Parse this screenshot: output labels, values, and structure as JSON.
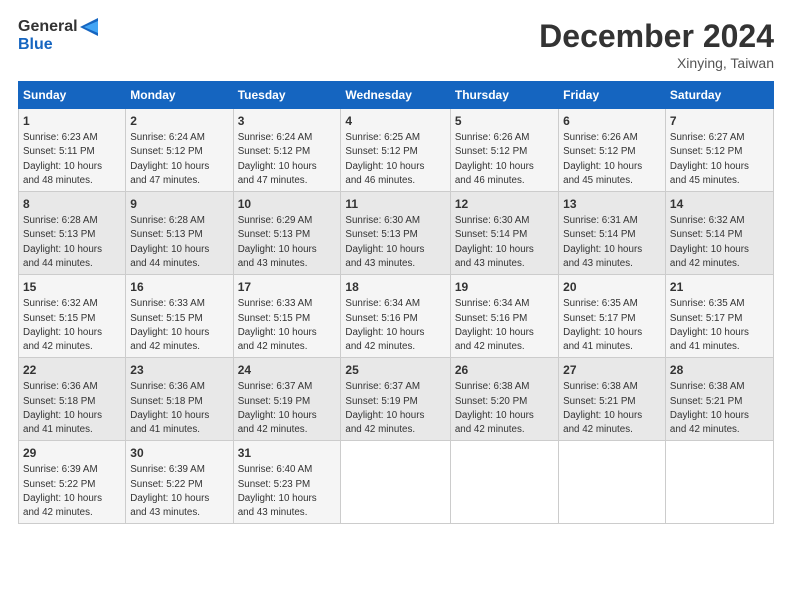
{
  "header": {
    "logo_line1": "General",
    "logo_line2": "Blue",
    "month_title": "December 2024",
    "location": "Xinying, Taiwan"
  },
  "days_of_week": [
    "Sunday",
    "Monday",
    "Tuesday",
    "Wednesday",
    "Thursday",
    "Friday",
    "Saturday"
  ],
  "weeks": [
    [
      {
        "day": "1",
        "info": "Sunrise: 6:23 AM\nSunset: 5:11 PM\nDaylight: 10 hours\nand 48 minutes."
      },
      {
        "day": "2",
        "info": "Sunrise: 6:24 AM\nSunset: 5:12 PM\nDaylight: 10 hours\nand 47 minutes."
      },
      {
        "day": "3",
        "info": "Sunrise: 6:24 AM\nSunset: 5:12 PM\nDaylight: 10 hours\nand 47 minutes."
      },
      {
        "day": "4",
        "info": "Sunrise: 6:25 AM\nSunset: 5:12 PM\nDaylight: 10 hours\nand 46 minutes."
      },
      {
        "day": "5",
        "info": "Sunrise: 6:26 AM\nSunset: 5:12 PM\nDaylight: 10 hours\nand 46 minutes."
      },
      {
        "day": "6",
        "info": "Sunrise: 6:26 AM\nSunset: 5:12 PM\nDaylight: 10 hours\nand 45 minutes."
      },
      {
        "day": "7",
        "info": "Sunrise: 6:27 AM\nSunset: 5:12 PM\nDaylight: 10 hours\nand 45 minutes."
      }
    ],
    [
      {
        "day": "8",
        "info": "Sunrise: 6:28 AM\nSunset: 5:13 PM\nDaylight: 10 hours\nand 44 minutes."
      },
      {
        "day": "9",
        "info": "Sunrise: 6:28 AM\nSunset: 5:13 PM\nDaylight: 10 hours\nand 44 minutes."
      },
      {
        "day": "10",
        "info": "Sunrise: 6:29 AM\nSunset: 5:13 PM\nDaylight: 10 hours\nand 43 minutes."
      },
      {
        "day": "11",
        "info": "Sunrise: 6:30 AM\nSunset: 5:13 PM\nDaylight: 10 hours\nand 43 minutes."
      },
      {
        "day": "12",
        "info": "Sunrise: 6:30 AM\nSunset: 5:14 PM\nDaylight: 10 hours\nand 43 minutes."
      },
      {
        "day": "13",
        "info": "Sunrise: 6:31 AM\nSunset: 5:14 PM\nDaylight: 10 hours\nand 43 minutes."
      },
      {
        "day": "14",
        "info": "Sunrise: 6:32 AM\nSunset: 5:14 PM\nDaylight: 10 hours\nand 42 minutes."
      }
    ],
    [
      {
        "day": "15",
        "info": "Sunrise: 6:32 AM\nSunset: 5:15 PM\nDaylight: 10 hours\nand 42 minutes."
      },
      {
        "day": "16",
        "info": "Sunrise: 6:33 AM\nSunset: 5:15 PM\nDaylight: 10 hours\nand 42 minutes."
      },
      {
        "day": "17",
        "info": "Sunrise: 6:33 AM\nSunset: 5:15 PM\nDaylight: 10 hours\nand 42 minutes."
      },
      {
        "day": "18",
        "info": "Sunrise: 6:34 AM\nSunset: 5:16 PM\nDaylight: 10 hours\nand 42 minutes."
      },
      {
        "day": "19",
        "info": "Sunrise: 6:34 AM\nSunset: 5:16 PM\nDaylight: 10 hours\nand 42 minutes."
      },
      {
        "day": "20",
        "info": "Sunrise: 6:35 AM\nSunset: 5:17 PM\nDaylight: 10 hours\nand 41 minutes."
      },
      {
        "day": "21",
        "info": "Sunrise: 6:35 AM\nSunset: 5:17 PM\nDaylight: 10 hours\nand 41 minutes."
      }
    ],
    [
      {
        "day": "22",
        "info": "Sunrise: 6:36 AM\nSunset: 5:18 PM\nDaylight: 10 hours\nand 41 minutes."
      },
      {
        "day": "23",
        "info": "Sunrise: 6:36 AM\nSunset: 5:18 PM\nDaylight: 10 hours\nand 41 minutes."
      },
      {
        "day": "24",
        "info": "Sunrise: 6:37 AM\nSunset: 5:19 PM\nDaylight: 10 hours\nand 42 minutes."
      },
      {
        "day": "25",
        "info": "Sunrise: 6:37 AM\nSunset: 5:19 PM\nDaylight: 10 hours\nand 42 minutes."
      },
      {
        "day": "26",
        "info": "Sunrise: 6:38 AM\nSunset: 5:20 PM\nDaylight: 10 hours\nand 42 minutes."
      },
      {
        "day": "27",
        "info": "Sunrise: 6:38 AM\nSunset: 5:21 PM\nDaylight: 10 hours\nand 42 minutes."
      },
      {
        "day": "28",
        "info": "Sunrise: 6:38 AM\nSunset: 5:21 PM\nDaylight: 10 hours\nand 42 minutes."
      }
    ],
    [
      {
        "day": "29",
        "info": "Sunrise: 6:39 AM\nSunset: 5:22 PM\nDaylight: 10 hours\nand 42 minutes."
      },
      {
        "day": "30",
        "info": "Sunrise: 6:39 AM\nSunset: 5:22 PM\nDaylight: 10 hours\nand 43 minutes."
      },
      {
        "day": "31",
        "info": "Sunrise: 6:40 AM\nSunset: 5:23 PM\nDaylight: 10 hours\nand 43 minutes."
      },
      null,
      null,
      null,
      null
    ]
  ]
}
